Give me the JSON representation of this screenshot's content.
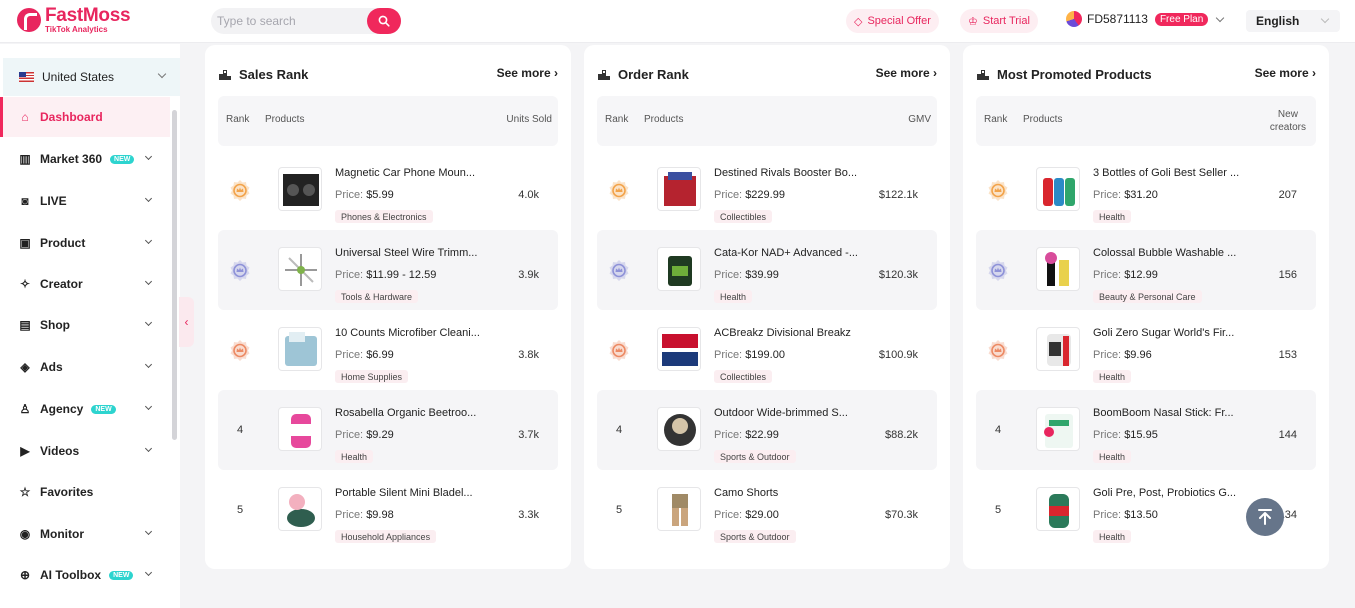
{
  "header": {
    "logo_name": "FastMoss",
    "logo_sub": "TikTok Analytics",
    "search_placeholder": "Type to search",
    "special_offer": "Special Offer",
    "start_trial": "Start Trial",
    "user_id": "FD5871113",
    "plan_badge": "Free Plan",
    "language": "English"
  },
  "sidebar": {
    "country": "United States",
    "items": [
      {
        "label": "Dashboard",
        "icon": "home-icon",
        "active": true,
        "new": false,
        "chevron": false
      },
      {
        "label": "Market 360",
        "icon": "chart-bar-icon",
        "active": false,
        "new": true,
        "chevron": true
      },
      {
        "label": "LIVE",
        "icon": "live-camera-icon",
        "active": false,
        "new": false,
        "chevron": true
      },
      {
        "label": "Product",
        "icon": "product-box-icon",
        "active": false,
        "new": false,
        "chevron": true
      },
      {
        "label": "Creator",
        "icon": "creator-star-icon",
        "active": false,
        "new": false,
        "chevron": true
      },
      {
        "label": "Shop",
        "icon": "shop-icon",
        "active": false,
        "new": false,
        "chevron": true
      },
      {
        "label": "Ads",
        "icon": "ads-icon",
        "active": false,
        "new": false,
        "chevron": true
      },
      {
        "label": "Agency",
        "icon": "agency-icon",
        "active": false,
        "new": true,
        "chevron": true
      },
      {
        "label": "Videos",
        "icon": "video-icon",
        "active": false,
        "new": false,
        "chevron": true
      },
      {
        "label": "Favorites",
        "icon": "star-icon",
        "active": false,
        "new": false,
        "chevron": false
      },
      {
        "label": "Monitor",
        "icon": "monitor-pin-icon",
        "active": false,
        "new": false,
        "chevron": true
      },
      {
        "label": "AI Toolbox",
        "icon": "ai-toolbox-icon",
        "active": false,
        "new": true,
        "chevron": true
      }
    ],
    "new_badge": "NEW"
  },
  "panels": [
    {
      "title": "Sales Rank",
      "see_more": "See more",
      "col_rank": "Rank",
      "col_products": "Products",
      "col_metric": "Units Sold",
      "rows": [
        {
          "rank": "1",
          "medal": "gold",
          "name": "Magnetic Car Phone Moun...",
          "price_label": "Price:",
          "price": "$5.99",
          "category": "Phones & Electronics",
          "metric": "4.0k"
        },
        {
          "rank": "2",
          "medal": "silver",
          "name": "Universal Steel Wire Trimm...",
          "price_label": "Price:",
          "price": "$11.99 - 12.59",
          "category": "Tools & Hardware",
          "metric": "3.9k"
        },
        {
          "rank": "3",
          "medal": "bronze",
          "name": "10 Counts Microfiber Cleani...",
          "price_label": "Price:",
          "price": "$6.99",
          "category": "Home Supplies",
          "metric": "3.8k"
        },
        {
          "rank": "4",
          "medal": "",
          "name": "Rosabella Organic Beetroo...",
          "price_label": "Price:",
          "price": "$9.29",
          "category": "Health",
          "metric": "3.7k"
        },
        {
          "rank": "5",
          "medal": "",
          "name": "Portable Silent Mini Bladel...",
          "price_label": "Price:",
          "price": "$9.98",
          "category": "Household Appliances",
          "metric": "3.3k"
        }
      ]
    },
    {
      "title": "Order Rank",
      "see_more": "See more",
      "col_rank": "Rank",
      "col_products": "Products",
      "col_metric": "GMV",
      "rows": [
        {
          "rank": "1",
          "medal": "gold",
          "name": "Destined Rivals Booster Bo...",
          "price_label": "Price:",
          "price": "$229.99",
          "category": "Collectibles",
          "metric": "$122.1k"
        },
        {
          "rank": "2",
          "medal": "silver",
          "name": "Cata-Kor NAD+ Advanced -...",
          "price_label": "Price:",
          "price": "$39.99",
          "category": "Health",
          "metric": "$120.3k"
        },
        {
          "rank": "3",
          "medal": "bronze",
          "name": "ACBreakz Divisional Breakz",
          "price_label": "Price:",
          "price": "$199.00",
          "category": "Collectibles",
          "metric": "$100.9k"
        },
        {
          "rank": "4",
          "medal": "",
          "name": "Outdoor Wide-brimmed S...",
          "price_label": "Price:",
          "price": "$22.99",
          "category": "Sports & Outdoor",
          "metric": "$88.2k"
        },
        {
          "rank": "5",
          "medal": "",
          "name": "Camo Shorts",
          "price_label": "Price:",
          "price": "$29.00",
          "category": "Sports & Outdoor",
          "metric": "$70.3k"
        }
      ]
    },
    {
      "title": "Most Promoted Products",
      "see_more": "See more",
      "col_rank": "Rank",
      "col_products": "Products",
      "col_metric_1": "New",
      "col_metric_2": "creators",
      "rows": [
        {
          "rank": "1",
          "medal": "gold",
          "name": "3 Bottles of Goli Best Seller ...",
          "price_label": "Price:",
          "price": "$31.20",
          "category": "Health",
          "metric": "207"
        },
        {
          "rank": "2",
          "medal": "silver",
          "name": "Colossal Bubble Washable ...",
          "price_label": "Price:",
          "price": "$12.99",
          "category": "Beauty & Personal Care",
          "metric": "156"
        },
        {
          "rank": "3",
          "medal": "bronze",
          "name": "Goli Zero Sugar World's Fir...",
          "price_label": "Price:",
          "price": "$9.96",
          "category": "Health",
          "metric": "153"
        },
        {
          "rank": "4",
          "medal": "",
          "name": "BoomBoom Nasal Stick: Fr...",
          "price_label": "Price:",
          "price": "$15.95",
          "category": "Health",
          "metric": "144"
        },
        {
          "rank": "5",
          "medal": "",
          "name": "Goli Pre, Post, Probiotics G...",
          "price_label": "Price:",
          "price": "$13.50",
          "category": "Health",
          "metric": "134"
        }
      ]
    }
  ],
  "colors": {
    "brand": "#f0285c",
    "gold": "#f2a34a",
    "silver": "#8e92d8",
    "bronze": "#ec8a64"
  }
}
